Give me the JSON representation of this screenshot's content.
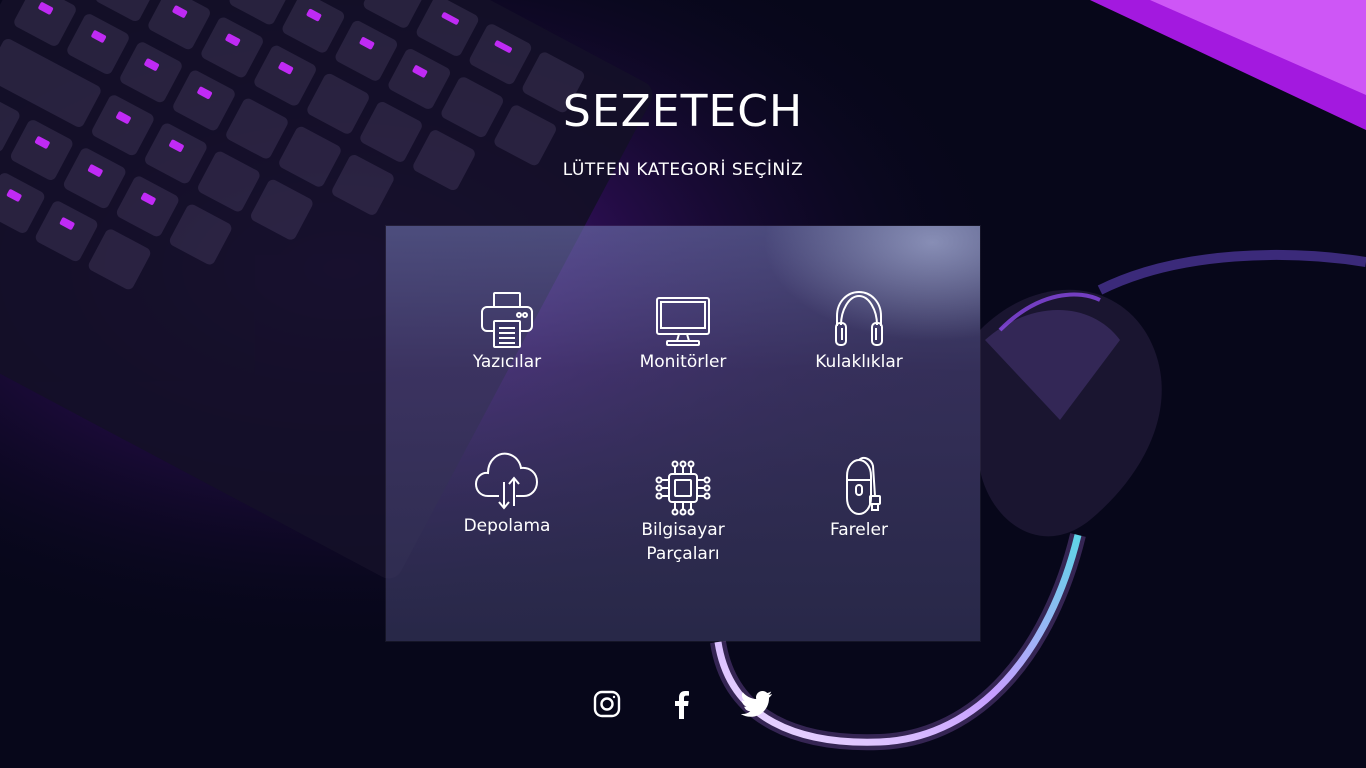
{
  "header": {
    "title": "SEZETECH",
    "subtitle": "LÜTFEN KATEGORİ SEÇİNİZ"
  },
  "categories": [
    {
      "label": "Yazıcılar",
      "icon": "printer-icon"
    },
    {
      "label": "Monitörler",
      "icon": "monitor-icon"
    },
    {
      "label": "Kulaklıklar",
      "icon": "headphones-icon"
    },
    {
      "label": "Depolama",
      "icon": "cloud-storage-icon"
    },
    {
      "label": "Bilgisayar",
      "label2": "Parçaları",
      "icon": "chip-icon"
    },
    {
      "label": "Fareler",
      "icon": "mouse-icon"
    }
  ],
  "social": [
    "instagram-icon",
    "facebook-icon",
    "twitter-icon"
  ],
  "colors": {
    "background": "#07071a",
    "accent_purple": "#b01cff",
    "accent_cyan": "#3ff0e0",
    "text": "#ffffff"
  }
}
